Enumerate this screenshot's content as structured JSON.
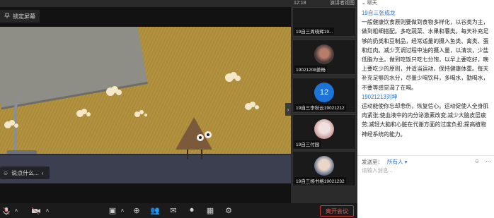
{
  "share": {
    "label": "锁定屏幕"
  },
  "caption": {
    "placeholder": "说点什么..."
  },
  "window": {
    "time": "12:18",
    "view_label": "演讲者视图"
  },
  "participants": [
    {
      "name": "19自三周晓辉19..."
    },
    {
      "name": "19021208姜畅"
    },
    {
      "name": "19自三李秋云19021212",
      "avatar_number": "12"
    },
    {
      "name": "19自三付园"
    },
    {
      "name": "19自三杨书格19021232"
    }
  ],
  "chat": {
    "title": "聊天",
    "messages": [
      {
        "sender": "19自三张成龙",
        "text": "一般健康饮食原则要做到食物多样化，以谷类为主，做到粗细搭配。多吃蔬菜、水果和薯类。每天补充足够的奶类和豆制品，经常适量的摄入鱼类、禽类、蛋和红肉。减少烹调过程中油的摄入量，以清淡，少盐低脂为主。做到吃饭只吃七分饱，以早上要吃好，晚上要吃少的原则，并适当运动，保持健康体重。每天补充足够的水分，尽量少喝饮料，多喝水，勤喝水，不要等感觉渴了在喝。"
      },
      {
        "sender": "19021213刘坤",
        "text": "运动能使你忘却悲伤，恢复信心。运动促使人全身肌肉紧张;使血液中的内分泌激素改变;减少大脑皮层疲劳;减轻大脑和心脏在代谢方面的过度负担;提高植物神经系统的能力。"
      }
    ],
    "send_to_label": "发送至：",
    "send_to_value": "所有人",
    "input_placeholder": "请输入消息..."
  },
  "toolbar": {
    "leave_label": "离开会议"
  },
  "colors": {
    "accent": "#2e72c9",
    "leave": "#e25b5b",
    "avatar_blue": "#1c74d9"
  }
}
